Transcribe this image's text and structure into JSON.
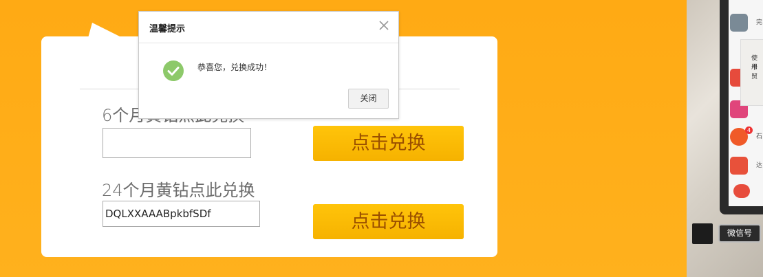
{
  "form": {
    "row1_label": "6个月黄钻点此兑换",
    "row1_value": "",
    "row1_button": "点击兑换",
    "row2_label": "24个月黄钻点此兑换",
    "row2_value": "DQLXXAAABpkbfSDf",
    "row2_button": "点击兑换"
  },
  "dialog": {
    "title": "温馨提示",
    "message": "恭喜您，兑换成功！",
    "close_button": "关闭",
    "close_icon": "close-icon",
    "status_icon": "success-check-icon"
  },
  "side": {
    "popup_line1": "使用",
    "popup_line2": "卡贸",
    "app1_text": "完",
    "app2_text": "石",
    "app3_text": "达",
    "badge_count": "4",
    "wechat_button": "微信号"
  },
  "colors": {
    "background": "#FFAA14",
    "button": "#FFC40A",
    "button_text": "#9a4f00",
    "success_green": "#8DC96A"
  }
}
